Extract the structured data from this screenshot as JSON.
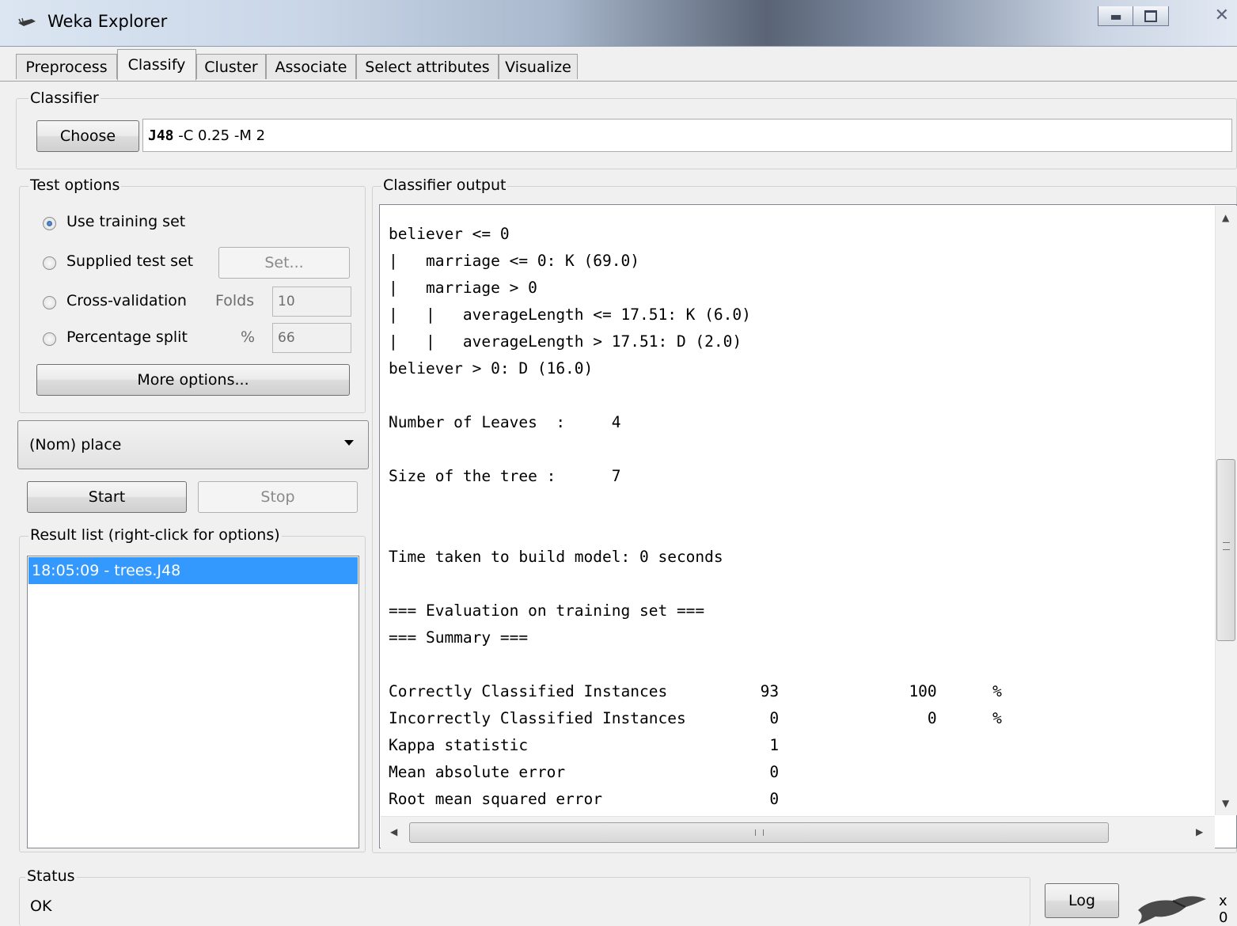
{
  "window": {
    "title": "Weka Explorer",
    "controls": [
      "minimize",
      "maximize",
      "close"
    ]
  },
  "tabs": [
    {
      "label": "Preprocess",
      "active": false
    },
    {
      "label": "Classify",
      "active": true
    },
    {
      "label": "Cluster",
      "active": false
    },
    {
      "label": "Associate",
      "active": false
    },
    {
      "label": "Select attributes",
      "active": false
    },
    {
      "label": "Visualize",
      "active": false
    }
  ],
  "classifier": {
    "group_label": "Classifier",
    "choose_label": "Choose",
    "name": "J48",
    "options": "-C 0.25 -M 2"
  },
  "test_options": {
    "group_label": "Test options",
    "use_training": "Use training set",
    "supplied_test": "Supplied test set",
    "set_label": "Set...",
    "cross_validation": "Cross-validation",
    "folds_label": "Folds",
    "folds_value": "10",
    "percentage_split": "Percentage split",
    "percent_label": "%",
    "percent_value": "66",
    "selected": "Use training set",
    "more_options": "More options..."
  },
  "class_attribute": {
    "value": "(Nom) place"
  },
  "run": {
    "start_label": "Start",
    "stop_label": "Stop"
  },
  "result_list": {
    "label": "Result list (right-click for options)",
    "items": [
      "18:05:09 - trees.J48"
    ]
  },
  "output": {
    "label": "Classifier output",
    "lines": [
      "believer <= 0",
      "|   marriage <= 0: K (69.0)",
      "|   marriage > 0",
      "|   |   averageLength <= 17.51: K (6.0)",
      "|   |   averageLength > 17.51: D (2.0)",
      "believer > 0: D (16.0)",
      "",
      "Number of Leaves  :     4",
      "",
      "Size of the tree :      7",
      "",
      "",
      "Time taken to build model: 0 seconds",
      "",
      "=== Evaluation on training set ===",
      "=== Summary ===",
      "",
      "Correctly Classified Instances          93              100      %",
      "Incorrectly Classified Instances         0                0      %",
      "Kappa statistic                          1",
      "Mean absolute error                      0",
      "Root mean squared error                  0"
    ]
  },
  "status": {
    "label": "Status",
    "text": "OK",
    "log_label": "Log",
    "x_label": "x 0"
  }
}
